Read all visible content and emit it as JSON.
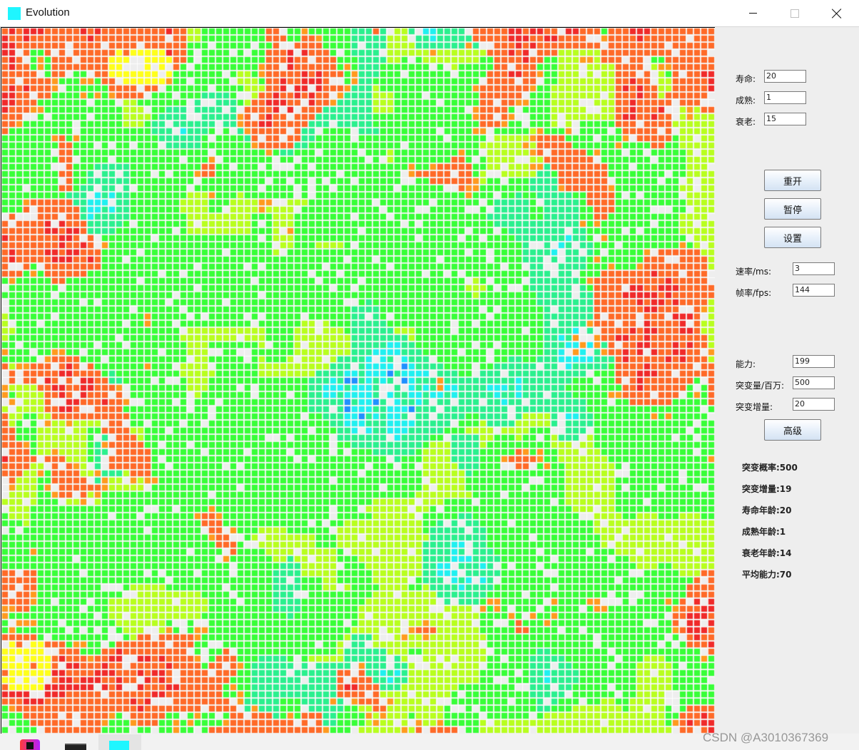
{
  "window": {
    "title": "Evolution",
    "icon_color": "#1ff6ff",
    "minimize_icon": "minimize-icon",
    "maximize_icon": "maximize-icon",
    "close_icon": "close-icon"
  },
  "controls": {
    "lifespan": {
      "label": "寿命:",
      "value": "20"
    },
    "maturity": {
      "label": "成熟:",
      "value": "1"
    },
    "aging": {
      "label": "衰老:",
      "value": "15"
    },
    "buttons": {
      "restart": "重开",
      "pause": "暂停",
      "settings": "设置",
      "advanced": "高级"
    },
    "rate": {
      "label": "速率/ms:",
      "value": "3"
    },
    "fps": {
      "label": "帧率/fps:",
      "value": "144"
    },
    "ability": {
      "label": "能力:",
      "value": "199"
    },
    "mutation_amount": {
      "label": "突变量/百万:",
      "value": "500"
    },
    "mutation_increment": {
      "label": "突变增量:",
      "value": "20"
    }
  },
  "stats": [
    "突变概率:500",
    "突变增量:19",
    "寿命年龄:20",
    "成熟年龄:1",
    "衰老年龄:14",
    "平均能力:70"
  ],
  "watermark": "CSDN @A3010367369",
  "grid": {
    "empty_color": "#eeeeee",
    "palette": {
      "red": "#f02a2a",
      "orange": "#ff6a28",
      "amber": "#ff9a1e",
      "yellow": "#ffff1a",
      "lime": "#b8ff1e",
      "green": "#38ff38",
      "teal": "#2af08e",
      "cyan": "#20f0f0",
      "blue": "#2090ff"
    }
  },
  "taskbar": {
    "icons": [
      "intellij-icon",
      "terminal-icon",
      "evolution-app-icon"
    ]
  }
}
